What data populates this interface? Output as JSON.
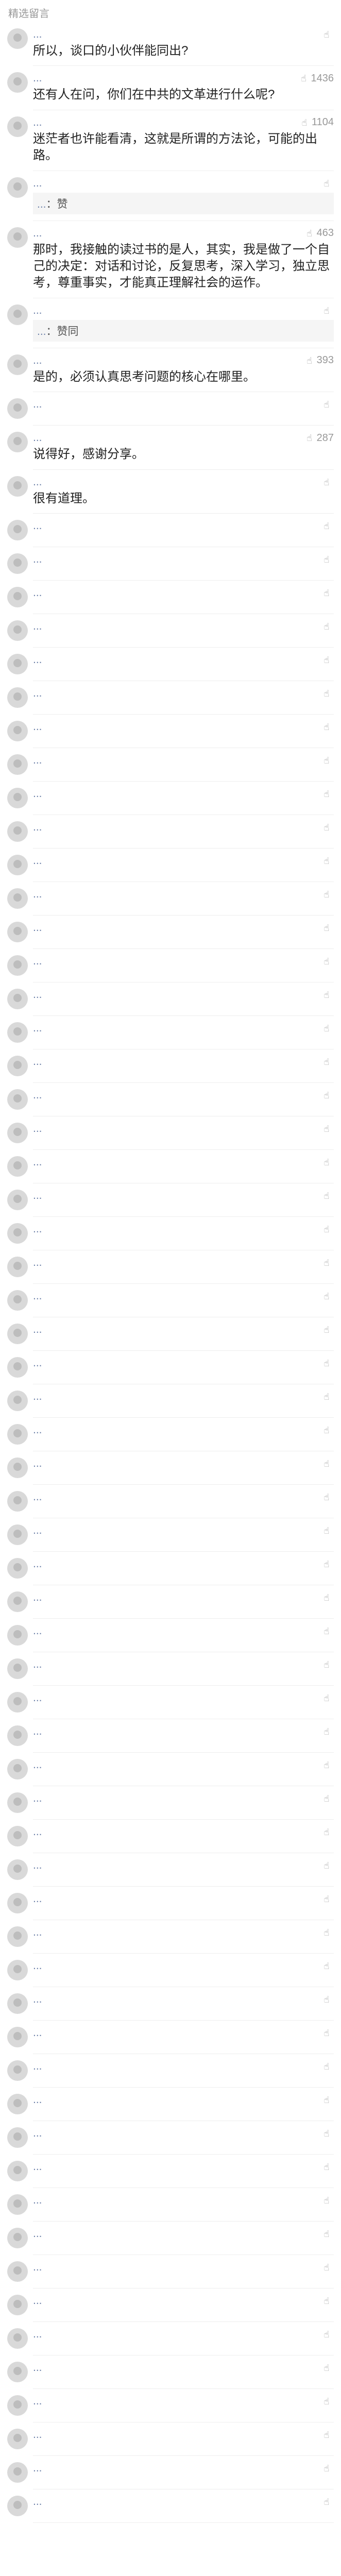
{
  "section_title": "精选留言",
  "comments": [
    {
      "user": "...",
      "likes": "",
      "text": "所以，谈口的小伙伴能同出?",
      "replies": [],
      "more": ""
    },
    {
      "user": "...",
      "likes": "1436",
      "text": "还有人在问，你们在中共的文革进行什么呢?",
      "replies": [],
      "more": ""
    },
    {
      "user": "...",
      "likes": "1104",
      "text": "迷茫者也许能看清，这就是所谓的方法论，可能的出路。",
      "replies": [],
      "more": ""
    },
    {
      "user": "...",
      "likes": "",
      "text": "",
      "replies": [
        {
          "name": "...",
          "text": "赞"
        }
      ],
      "more": ""
    },
    {
      "user": "...",
      "likes": "463",
      "text": "那时，我接触的读过书的是人，其实，我是做了一个自己的决定：对话和讨论，反复思考，深入学习，独立思考，尊重事实，才能真正理解社会的运作。",
      "replies": [],
      "more": ""
    },
    {
      "user": "...",
      "likes": "",
      "text": "",
      "replies": [
        {
          "name": "...",
          "text": "赞同"
        }
      ],
      "more": ""
    },
    {
      "user": "...",
      "likes": "393",
      "text": "是的，必须认真思考问题的核心在哪里。",
      "replies": [],
      "more": ""
    },
    {
      "user": "...",
      "likes": "",
      "text": "",
      "replies": [],
      "more": ""
    },
    {
      "user": "...",
      "likes": "287",
      "text": "说得好，感谢分享。",
      "replies": [],
      "more": ""
    },
    {
      "user": "...",
      "likes": "",
      "text": "很有道理。",
      "replies": [],
      "more": ""
    },
    {
      "user": "...",
      "likes": "",
      "text": "",
      "replies": [],
      "more": ""
    },
    {
      "user": "...",
      "likes": "",
      "text": "",
      "replies": [],
      "more": ""
    },
    {
      "user": "...",
      "likes": "",
      "text": "",
      "replies": [],
      "more": ""
    },
    {
      "user": "...",
      "likes": "",
      "text": "",
      "replies": [],
      "more": ""
    },
    {
      "user": "...",
      "likes": "",
      "text": "",
      "replies": [],
      "more": ""
    },
    {
      "user": "...",
      "likes": "",
      "text": "",
      "replies": [],
      "more": ""
    },
    {
      "user": "...",
      "likes": "",
      "text": "",
      "replies": [],
      "more": ""
    },
    {
      "user": "...",
      "likes": "",
      "text": "",
      "replies": [],
      "more": ""
    },
    {
      "user": "...",
      "likes": "",
      "text": "",
      "replies": [],
      "more": ""
    },
    {
      "user": "...",
      "likes": "",
      "text": "",
      "replies": [],
      "more": ""
    },
    {
      "user": "...",
      "likes": "",
      "text": "",
      "replies": [],
      "more": ""
    },
    {
      "user": "...",
      "likes": "",
      "text": "",
      "replies": [],
      "more": ""
    },
    {
      "user": "...",
      "likes": "",
      "text": "",
      "replies": [],
      "more": ""
    },
    {
      "user": "...",
      "likes": "",
      "text": "",
      "replies": [],
      "more": ""
    },
    {
      "user": "...",
      "likes": "",
      "text": "",
      "replies": [],
      "more": ""
    },
    {
      "user": "...",
      "likes": "",
      "text": "",
      "replies": [],
      "more": ""
    },
    {
      "user": "...",
      "likes": "",
      "text": "",
      "replies": [],
      "more": ""
    },
    {
      "user": "...",
      "likes": "",
      "text": "",
      "replies": [],
      "more": ""
    },
    {
      "user": "...",
      "likes": "",
      "text": "",
      "replies": [],
      "more": ""
    },
    {
      "user": "...",
      "likes": "",
      "text": "",
      "replies": [],
      "more": ""
    },
    {
      "user": "...",
      "likes": "",
      "text": "",
      "replies": [],
      "more": ""
    },
    {
      "user": "...",
      "likes": "",
      "text": "",
      "replies": [],
      "more": ""
    },
    {
      "user": "...",
      "likes": "",
      "text": "",
      "replies": [],
      "more": ""
    },
    {
      "user": "...",
      "likes": "",
      "text": "",
      "replies": [],
      "more": ""
    },
    {
      "user": "...",
      "likes": "",
      "text": "",
      "replies": [],
      "more": ""
    },
    {
      "user": "...",
      "likes": "",
      "text": "",
      "replies": [],
      "more": ""
    },
    {
      "user": "...",
      "likes": "",
      "text": "",
      "replies": [],
      "more": ""
    },
    {
      "user": "...",
      "likes": "",
      "text": "",
      "replies": [],
      "more": ""
    },
    {
      "user": "...",
      "likes": "",
      "text": "",
      "replies": [],
      "more": ""
    },
    {
      "user": "...",
      "likes": "",
      "text": "",
      "replies": [],
      "more": ""
    },
    {
      "user": "...",
      "likes": "",
      "text": "",
      "replies": [],
      "more": ""
    },
    {
      "user": "...",
      "likes": "",
      "text": "",
      "replies": [],
      "more": ""
    },
    {
      "user": "...",
      "likes": "",
      "text": "",
      "replies": [],
      "more": ""
    },
    {
      "user": "...",
      "likes": "",
      "text": "",
      "replies": [],
      "more": ""
    },
    {
      "user": "...",
      "likes": "",
      "text": "",
      "replies": [],
      "more": ""
    },
    {
      "user": "...",
      "likes": "",
      "text": "",
      "replies": [],
      "more": ""
    },
    {
      "user": "...",
      "likes": "",
      "text": "",
      "replies": [],
      "more": ""
    },
    {
      "user": "...",
      "likes": "",
      "text": "",
      "replies": [],
      "more": ""
    },
    {
      "user": "...",
      "likes": "",
      "text": "",
      "replies": [],
      "more": ""
    },
    {
      "user": "...",
      "likes": "",
      "text": "",
      "replies": [],
      "more": ""
    },
    {
      "user": "...",
      "likes": "",
      "text": "",
      "replies": [],
      "more": ""
    },
    {
      "user": "...",
      "likes": "",
      "text": "",
      "replies": [],
      "more": ""
    },
    {
      "user": "...",
      "likes": "",
      "text": "",
      "replies": [],
      "more": ""
    },
    {
      "user": "...",
      "likes": "",
      "text": "",
      "replies": [],
      "more": ""
    },
    {
      "user": "...",
      "likes": "",
      "text": "",
      "replies": [],
      "more": ""
    },
    {
      "user": "...",
      "likes": "",
      "text": "",
      "replies": [],
      "more": ""
    },
    {
      "user": "...",
      "likes": "",
      "text": "",
      "replies": [],
      "more": ""
    },
    {
      "user": "...",
      "likes": "",
      "text": "",
      "replies": [],
      "more": ""
    },
    {
      "user": "...",
      "likes": "",
      "text": "",
      "replies": [],
      "more": ""
    },
    {
      "user": "...",
      "likes": "",
      "text": "",
      "replies": [],
      "more": ""
    },
    {
      "user": "...",
      "likes": "",
      "text": "",
      "replies": [],
      "more": ""
    },
    {
      "user": "...",
      "likes": "",
      "text": "",
      "replies": [],
      "more": ""
    },
    {
      "user": "...",
      "likes": "",
      "text": "",
      "replies": [],
      "more": ""
    },
    {
      "user": "...",
      "likes": "",
      "text": "",
      "replies": [],
      "more": ""
    },
    {
      "user": "...",
      "likes": "",
      "text": "",
      "replies": [],
      "more": ""
    },
    {
      "user": "...",
      "likes": "",
      "text": "",
      "replies": [],
      "more": ""
    },
    {
      "user": "...",
      "likes": "",
      "text": "",
      "replies": [],
      "more": ""
    },
    {
      "user": "...",
      "likes": "",
      "text": "",
      "replies": [],
      "more": ""
    },
    {
      "user": "...",
      "likes": "",
      "text": "",
      "replies": [],
      "more": ""
    },
    {
      "user": "...",
      "likes": "",
      "text": "",
      "replies": [],
      "more": ""
    }
  ],
  "colors": {
    "username": "#6a7ea6",
    "text": "#222222",
    "meta": "#999999",
    "reply_bg": "#f5f5f5"
  }
}
